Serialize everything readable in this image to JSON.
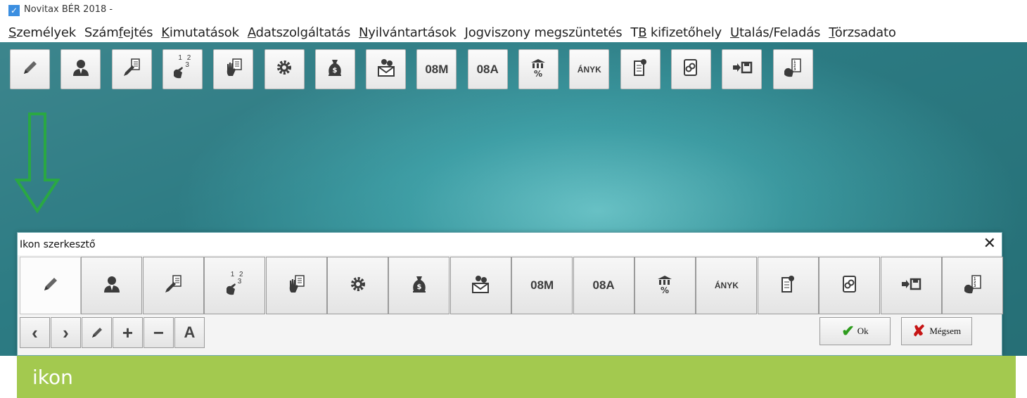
{
  "window": {
    "title": "Novitax BÉR 2018 -"
  },
  "menu": [
    {
      "acc": "S",
      "rest": "zemélyek"
    },
    {
      "pre": "Szám",
      "acc": "f",
      "rest": "ejtés"
    },
    {
      "acc": "K",
      "rest": "imutatások"
    },
    {
      "acc": "A",
      "rest": "datszolgáltatás"
    },
    {
      "acc": "N",
      "rest": "yilvántartások"
    },
    {
      "acc": "J",
      "rest": "ogviszony megszüntetés"
    },
    {
      "pre": "T",
      "acc": "B",
      "rest": " kifizetőhely"
    },
    {
      "acc": "U",
      "rest": "talás/Feladás"
    },
    {
      "acc": "T",
      "rest": "örzsadato"
    }
  ],
  "toolbar_icons": [
    "pencil-icon",
    "person-icon",
    "edit-document-icon",
    "hand-numbers-icon",
    "hand-document-icon",
    "gear-icon",
    "money-bag-icon",
    "money-envelope-icon",
    "08m-icon",
    "08a-icon",
    "bank-percent-icon",
    "anyk-icon",
    "document-coin-icon",
    "coins-document-icon",
    "export-save-icon",
    "hand-list-icon"
  ],
  "labels": {
    "m08": "08M",
    "a08": "08A",
    "anyk": "ÁNYK",
    "num12": "1 2",
    "num3": "3"
  },
  "dialog": {
    "title": "Ikon szerkesztő",
    "close": "✕",
    "ok": "Ok",
    "cancel": "Mégsem",
    "controls": {
      "prev": "‹",
      "next": "›",
      "add": "+",
      "remove": "−",
      "text": "A"
    }
  },
  "caption": "ikon",
  "colors": {
    "accent_green": "#a3c94f",
    "arrow_green": "#2aa843",
    "ok_green": "#2e9c1d",
    "cancel_red": "#c61515",
    "desktop_teal": "#3f9fa6"
  }
}
